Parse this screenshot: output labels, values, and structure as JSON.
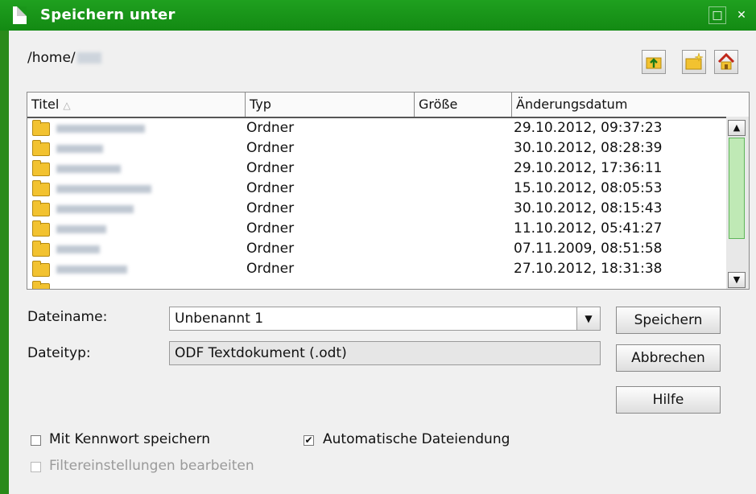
{
  "window": {
    "title": "Speichern unter"
  },
  "path": {
    "text": "/home/"
  },
  "toolbar": {
    "up_icon": "folder-up-icon",
    "new_folder_icon": "new-folder-icon",
    "home_icon": "home-icon"
  },
  "list": {
    "columns": [
      "Titel",
      "Typ",
      "Größe",
      "Änderungsdatum"
    ],
    "sort_indicator": "△",
    "rows": [
      {
        "type": "Ordner",
        "date": "29.10.2012, 09:37:23"
      },
      {
        "type": "Ordner",
        "date": "30.10.2012, 08:28:39"
      },
      {
        "type": "Ordner",
        "date": "29.10.2012, 17:36:11"
      },
      {
        "type": "Ordner",
        "date": "15.10.2012, 08:05:53"
      },
      {
        "type": "Ordner",
        "date": "30.10.2012, 08:15:43"
      },
      {
        "type": "Ordner",
        "date": "11.10.2012, 05:41:27"
      },
      {
        "type": "Ordner",
        "date": "07.11.2009, 08:51:58"
      },
      {
        "type": "Ordner",
        "date": "27.10.2012, 18:31:38"
      }
    ]
  },
  "form": {
    "filename_label": "Dateiname:",
    "filename_value": "Unbenannt 1",
    "filetype_label": "Dateityp:",
    "filetype_value": "ODF Textdokument (.odt)"
  },
  "buttons": {
    "save": "Speichern",
    "cancel": "Abbrechen",
    "help": "Hilfe"
  },
  "options": {
    "password_label": "Mit Kennwort speichern",
    "password_checked": false,
    "auto_ext_label": "Automatische Dateiendung",
    "auto_ext_checked": true,
    "filter_label": "Filtereinstellungen bearbeiten",
    "filter_checked": false,
    "filter_enabled": false
  },
  "colors": {
    "titlebar": "#1a961a",
    "scroll_thumb": "#bfe9b5"
  }
}
